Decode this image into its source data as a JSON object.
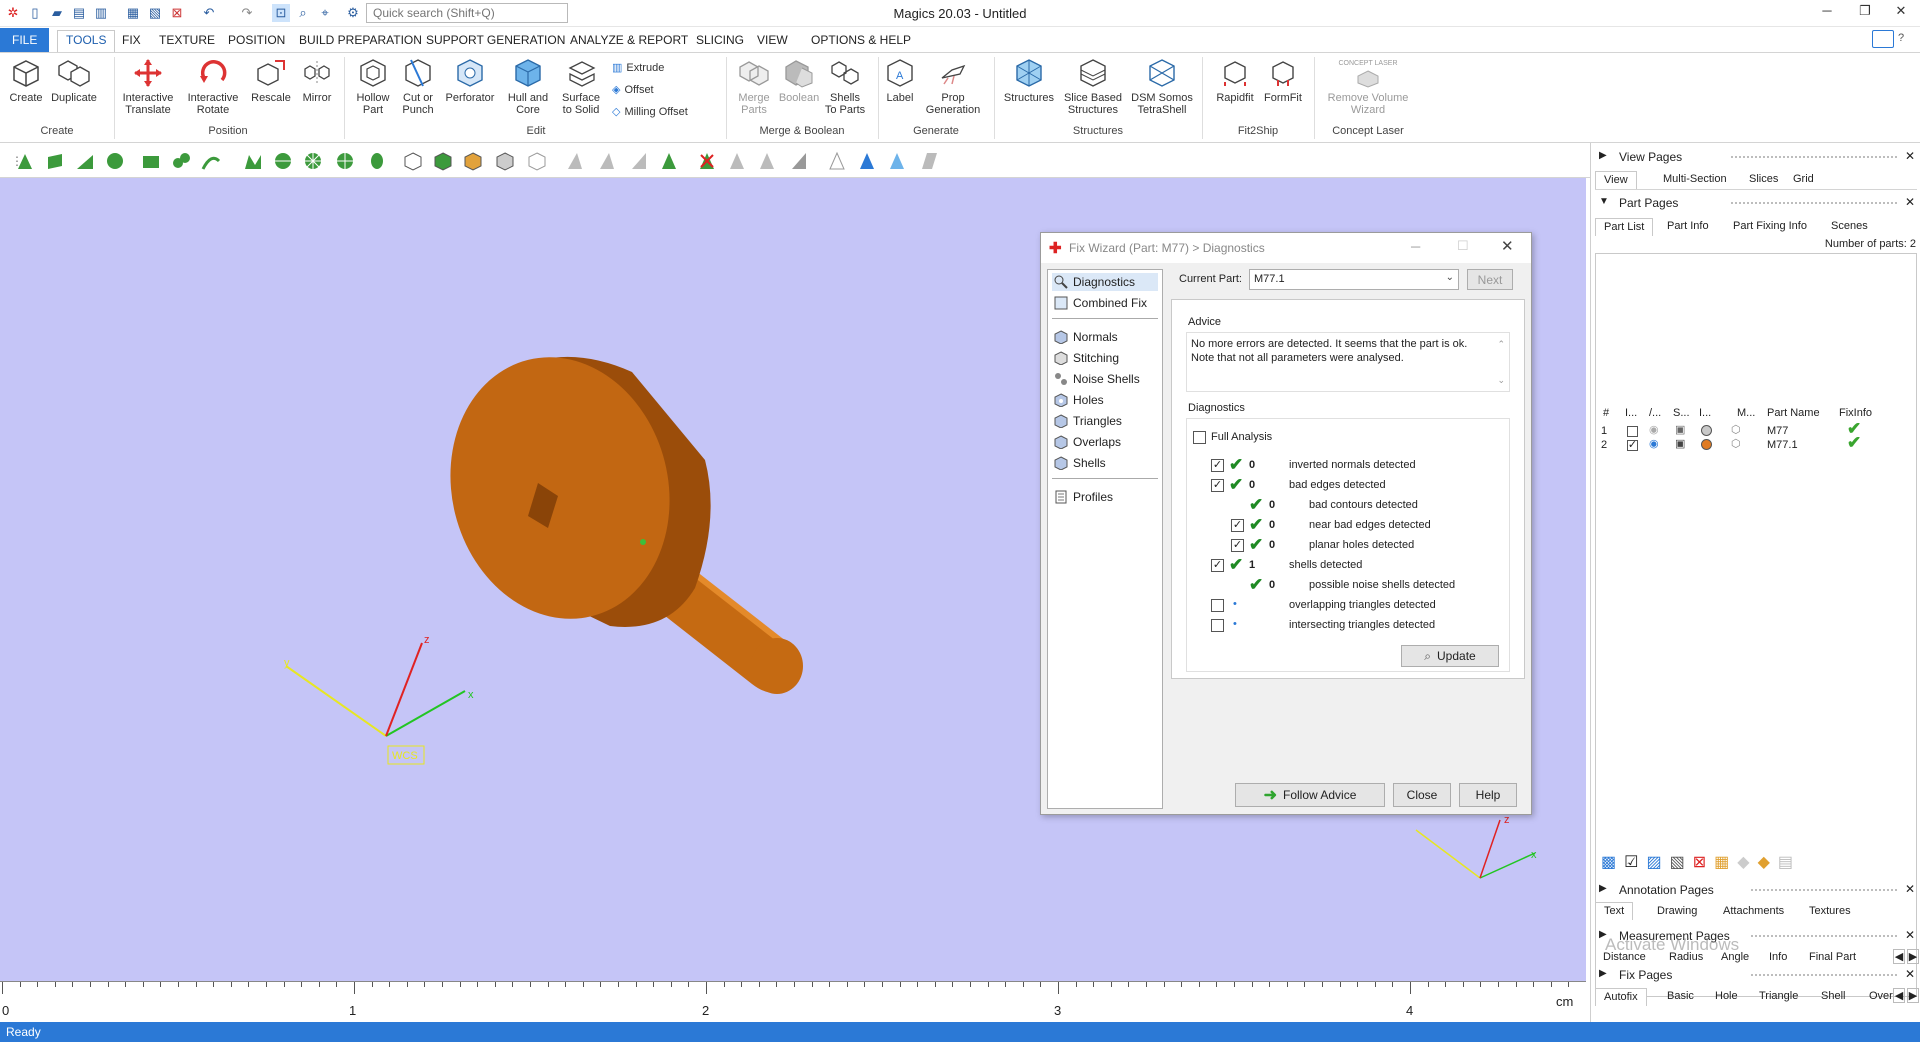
{
  "app": {
    "title": "Magics 20.03 - Untitled"
  },
  "search": {
    "placeholder": "Quick search (Shift+Q)"
  },
  "ribbon_tabs": [
    "FILE",
    "TOOLS",
    "FIX",
    "TEXTURE",
    "POSITION",
    "BUILD PREPARATION",
    "SUPPORT GENERATION",
    "ANALYZE & REPORT",
    "SLICING",
    "VIEW",
    "OPTIONS & HELP"
  ],
  "ribbon": {
    "create": {
      "create": "Create",
      "duplicate": "Duplicate",
      "group": "Create"
    },
    "position": {
      "interactive_translate": "Interactive Translate",
      "interactive_rotate": "Interactive Rotate",
      "rescale": "Rescale",
      "mirror": "Mirror",
      "group": "Position"
    },
    "edit": {
      "hollow_part": "Hollow Part",
      "cut_or_punch": "Cut or Punch",
      "perforator": "Perforator",
      "hull_and_core": "Hull and Core",
      "surface_to_solid": "Surface to Solid",
      "extrude": "Extrude",
      "offset": "Offset",
      "milling_offset": "Milling Offset",
      "group": "Edit"
    },
    "merge": {
      "merge_parts": "Merge Parts",
      "boolean": "Boolean",
      "shells_to_parts": "Shells To Parts",
      "group": "Merge & Boolean"
    },
    "generate": {
      "label": "Label",
      "prop_generation": "Prop Generation",
      "group": "Generate"
    },
    "structures": {
      "structures": "Structures",
      "slice_based": "Slice Based Structures",
      "dsm": "DSM Somos TetraShell",
      "group": "Structures"
    },
    "fit2ship": {
      "rapidfit": "Rapidfit",
      "formfit": "FormFit",
      "group": "Fit2Ship"
    },
    "concept": {
      "remove_volume": "Remove Volume Wizard",
      "group": "Concept Laser",
      "logo": "CONCEPT LASER"
    }
  },
  "viewport": {
    "wcs_label": "WCS",
    "x": "x",
    "y": "y",
    "z": "z"
  },
  "ruler": {
    "labels": [
      "0",
      "1",
      "2",
      "3",
      "4"
    ],
    "unit": "cm"
  },
  "status": {
    "text": "Ready"
  },
  "dialog": {
    "title": "Fix Wizard (Part: M77) > Diagnostics",
    "nav": [
      "Diagnostics",
      "Combined Fix",
      "Normals",
      "Stitching",
      "Noise Shells",
      "Holes",
      "Triangles",
      "Overlaps",
      "Shells",
      "Profiles"
    ],
    "current_part_label": "Current Part:",
    "current_part_value": "M77.1",
    "next_button": "Next",
    "advice_title": "Advice",
    "advice_text": "No more errors are detected. It seems that the part is ok. Note that not all parameters were analysed.",
    "diagnostics_title": "Diagnostics",
    "full_analysis": "Full Analysis",
    "rows": [
      {
        "count": "0",
        "label": "inverted normals detected",
        "checked": true,
        "ok": true,
        "indent": 0
      },
      {
        "count": "0",
        "label": "bad edges detected",
        "checked": true,
        "ok": true,
        "indent": 0
      },
      {
        "count": "0",
        "label": "bad contours detected",
        "checked": null,
        "ok": true,
        "indent": 1
      },
      {
        "count": "0",
        "label": "near bad edges detected",
        "checked": true,
        "ok": true,
        "indent": 1
      },
      {
        "count": "0",
        "label": "planar holes detected",
        "checked": true,
        "ok": true,
        "indent": 1
      },
      {
        "count": "1",
        "label": "shells detected",
        "checked": true,
        "ok": true,
        "indent": 0
      },
      {
        "count": "0",
        "label": "possible noise shells detected",
        "checked": null,
        "ok": true,
        "indent": 1
      },
      {
        "count": "",
        "label": "overlapping triangles detected",
        "checked": false,
        "ok": false,
        "indent": 0
      },
      {
        "count": "",
        "label": "intersecting triangles detected",
        "checked": false,
        "ok": false,
        "indent": 0
      }
    ],
    "update_button": "Update",
    "follow_advice_button": "Follow Advice",
    "close_button": "Close",
    "help_button": "Help"
  },
  "right_panel": {
    "view_pages": {
      "title": "View Pages",
      "tabs": [
        "View",
        "Multi-Section",
        "Slices",
        "Grid"
      ]
    },
    "part_pages": {
      "title": "Part Pages",
      "tabs": [
        "Part List",
        "Part Info",
        "Part Fixing Info",
        "Scenes"
      ],
      "number_of_parts": "Number of parts: 2"
    },
    "part_table": {
      "headers": [
        "#",
        "I...",
        "/...",
        "S...",
        "I...",
        "M...",
        "Part Name",
        "FixInfo"
      ],
      "rows": [
        {
          "num": "1",
          "name": "M77",
          "checked": false,
          "color": "#c9c9c9"
        },
        {
          "num": "2",
          "name": "M77.1",
          "checked": true,
          "color": "#e07b22"
        }
      ]
    },
    "annotation_pages": {
      "title": "Annotation Pages",
      "tabs": [
        "Text",
        "Drawing",
        "Attachments",
        "Textures"
      ]
    },
    "measurement_pages": {
      "title": "Measurement Pages",
      "tabs": [
        "Distance",
        "Radius",
        "Angle",
        "Info",
        "Final Part"
      ]
    },
    "fix_pages": {
      "title": "Fix Pages",
      "tabs": [
        "Autofix",
        "Basic",
        "Hole",
        "Triangle",
        "Shell",
        "Over"
      ]
    },
    "watermark": "Activate Windows"
  }
}
